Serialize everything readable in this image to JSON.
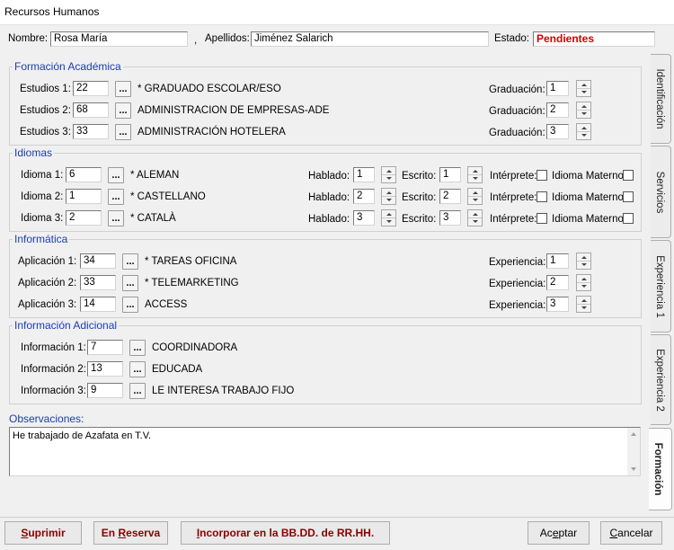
{
  "window": {
    "title": "Recursos Humanos"
  },
  "header": {
    "nombre_label": "Nombre:",
    "nombre_value": "Rosa María",
    "comma": ",",
    "apellidos_label": "Apellidos:",
    "apellidos_value": "Jiménez Salarich",
    "estado_label": "Estado:",
    "estado_value": "Pendientes"
  },
  "colors": {
    "group_title": "#1a3cb5",
    "status": "#d40000",
    "danger_button": "#8b0000"
  },
  "formacion": {
    "title": "Formación Académica",
    "rows": [
      {
        "label": "Estudios 1:",
        "code": "22",
        "desc": "* GRADUADO ESCOLAR/ESO",
        "grad_label": "Graduación:",
        "grad_value": "1"
      },
      {
        "label": "Estudios 2:",
        "code": "68",
        "desc": "ADMINISTRACION DE EMPRESAS-ADE",
        "grad_label": "Graduación:",
        "grad_value": "2"
      },
      {
        "label": "Estudios 3:",
        "code": "33",
        "desc": "ADMINISTRACIÓN HOTELERA",
        "grad_label": "Graduación:",
        "grad_value": "3"
      }
    ]
  },
  "idiomas": {
    "title": "Idiomas",
    "rows": [
      {
        "label": "Idioma 1:",
        "code": "6",
        "desc": "* ALEMAN",
        "hablado_label": "Hablado:",
        "hablado": "1",
        "escrito_label": "Escrito:",
        "escrito": "1",
        "interprete_label": "Intérprete:",
        "materno_label": "Idioma Materno:"
      },
      {
        "label": "Idioma 2:",
        "code": "1",
        "desc": "* CASTELLANO",
        "hablado_label": "Hablado:",
        "hablado": "2",
        "escrito_label": "Escrito:",
        "escrito": "2",
        "interprete_label": "Intérprete:",
        "materno_label": "Idioma Materno:"
      },
      {
        "label": "Idioma 3:",
        "code": "2",
        "desc": "* CATALÀ",
        "hablado_label": "Hablado:",
        "hablado": "3",
        "escrito_label": "Escrito:",
        "escrito": "3",
        "interprete_label": "Intérprete:",
        "materno_label": "Idioma Materno:"
      }
    ]
  },
  "informatica": {
    "title": "Informática",
    "rows": [
      {
        "label": "Aplicación 1:",
        "code": "34",
        "desc": "* TAREAS OFICINA",
        "exp_label": "Experiencia:",
        "exp_value": "1"
      },
      {
        "label": "Aplicación 2:",
        "code": "33",
        "desc": "* TELEMARKETING",
        "exp_label": "Experiencia:",
        "exp_value": "2"
      },
      {
        "label": "Aplicación 3:",
        "code": "14",
        "desc": "ACCESS",
        "exp_label": "Experiencia:",
        "exp_value": "3"
      }
    ]
  },
  "adicional": {
    "title": "Información Adicional",
    "rows": [
      {
        "label": "Información 1:",
        "code": "7",
        "desc": "COORDINADORA"
      },
      {
        "label": "Información 2:",
        "code": "13",
        "desc": "EDUCADA"
      },
      {
        "label": "Información 3:",
        "code": "9",
        "desc": "LE INTERESA TRABAJO FIJO"
      }
    ]
  },
  "dots_label": "...",
  "observaciones": {
    "label": "Observaciones:",
    "value": "He trabajado de Azafata en T.V."
  },
  "tabs": [
    {
      "label": "Identificación"
    },
    {
      "label": "Servicios"
    },
    {
      "label": "Experiencia 1"
    },
    {
      "label": "Experiencia 2"
    },
    {
      "label": "Formación"
    }
  ],
  "buttons": {
    "suprimir": {
      "first": "S",
      "rest": "uprimir"
    },
    "reserva": {
      "pre": "En ",
      "ul": "R",
      "rest": "eserva"
    },
    "incorporar": {
      "first": "I",
      "rest": "ncorporar en la BB.DD. de RR.HH."
    },
    "aceptar": {
      "pre": "Ac",
      "ul": "e",
      "rest": "ptar"
    },
    "cancelar": {
      "first": "C",
      "rest": "ancelar"
    }
  }
}
